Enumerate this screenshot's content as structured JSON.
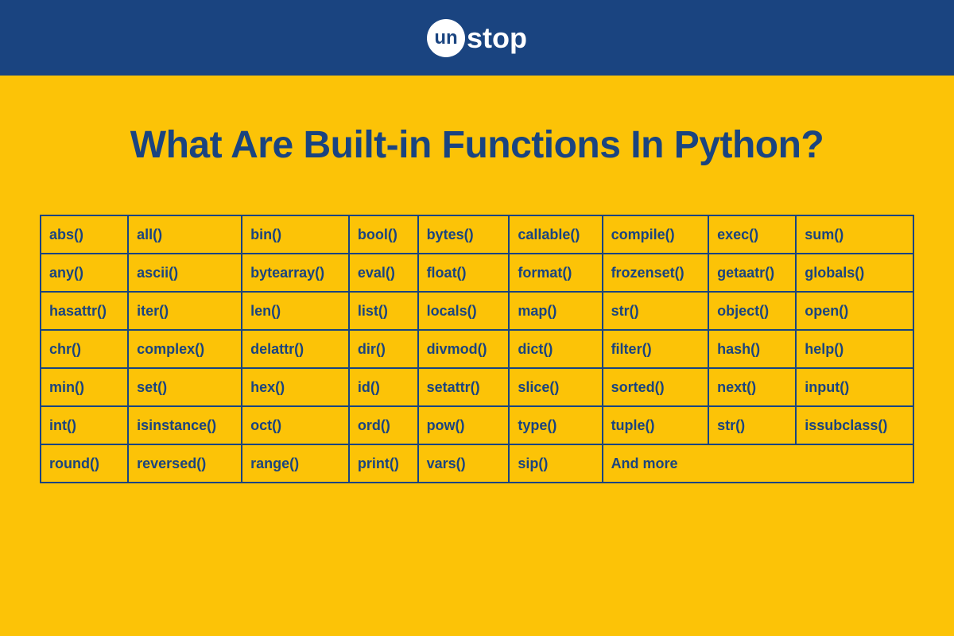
{
  "logo": {
    "circle_text": "un",
    "rest_text": "stop"
  },
  "title": "What Are Built-in Functions In Python?",
  "table": {
    "rows": [
      [
        "abs()",
        "all()",
        "bin()",
        "bool()",
        "bytes()",
        "callable()",
        "compile()",
        "exec()",
        "sum()"
      ],
      [
        "any()",
        "ascii()",
        "bytearray()",
        "eval()",
        "float()",
        "format()",
        "frozenset()",
        "getaatr()",
        "globals()"
      ],
      [
        "hasattr()",
        "iter()",
        "len()",
        "list()",
        "locals()",
        "map()",
        "str()",
        "object()",
        "open()"
      ],
      [
        "chr()",
        "complex()",
        "delattr()",
        "dir()",
        "divmod()",
        "dict()",
        "filter()",
        "hash()",
        "help()"
      ],
      [
        "min()",
        "set()",
        "hex()",
        "id()",
        "setattr()",
        "slice()",
        "sorted()",
        "next()",
        "input()"
      ],
      [
        "int()",
        "isinstance()",
        "oct()",
        "ord()",
        "pow()",
        "type()",
        "tuple()",
        "str()",
        "issubclass()"
      ]
    ],
    "last_row": [
      "round()",
      "reversed()",
      "range()",
      "print()",
      "vars()",
      "sip()"
    ],
    "more_text": "And more"
  }
}
